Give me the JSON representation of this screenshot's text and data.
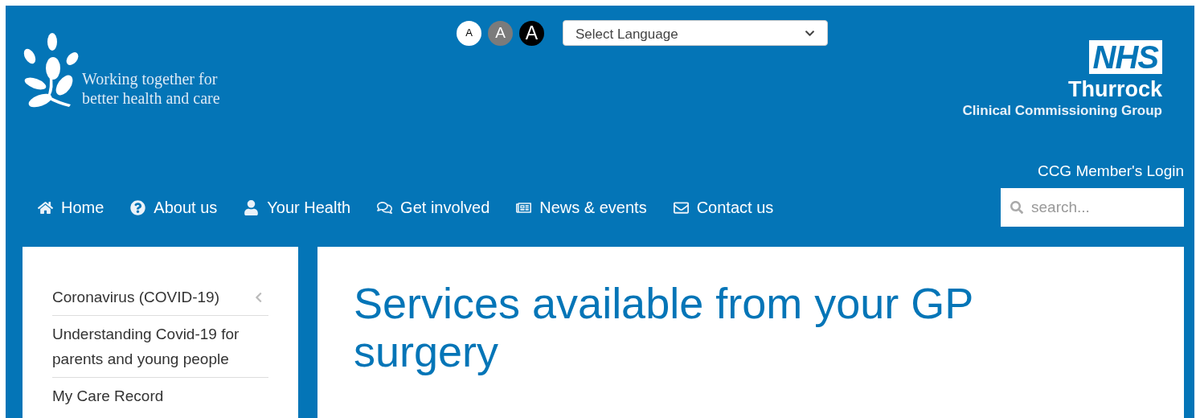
{
  "header": {
    "tagline": "Working together for better health and care",
    "text_size_buttons": [
      {
        "label": "A",
        "kind": "normal"
      },
      {
        "label": "A",
        "kind": "large"
      },
      {
        "label": "A",
        "kind": "larger"
      }
    ],
    "language_select": {
      "value": "Select Language"
    },
    "org": {
      "badge": "NHS",
      "name": "Thurrock",
      "subtitle": "Clinical Commissioning Group"
    },
    "login_link": "CCG Member's Login"
  },
  "nav": [
    {
      "label": "Home",
      "kind": "home"
    },
    {
      "label": "About us",
      "kind": "help"
    },
    {
      "label": "Your Health",
      "kind": "user"
    },
    {
      "label": "Get involved",
      "kind": "chat"
    },
    {
      "label": "News & events",
      "kind": "news"
    },
    {
      "label": "Contact us",
      "kind": "mail"
    }
  ],
  "search": {
    "placeholder": "search..."
  },
  "sidebar": {
    "items": [
      {
        "label": "Coronavirus (COVID-19)",
        "has_children": true
      },
      {
        "label": "Understanding Covid-19 for parents and young people",
        "has_children": false
      },
      {
        "label": "My Care Record",
        "has_children": false
      }
    ]
  },
  "page_title": "Services available from your GP surgery"
}
